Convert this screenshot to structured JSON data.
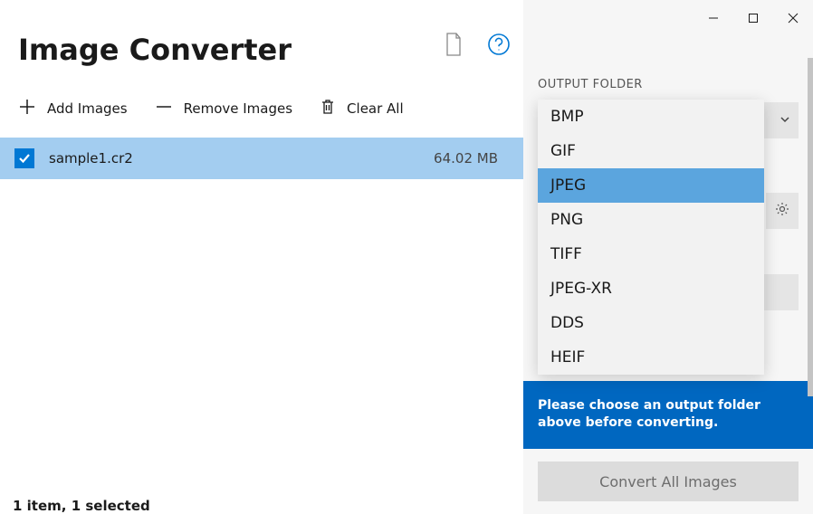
{
  "app": {
    "title": "Image Converter"
  },
  "toolbar": {
    "add": "Add Images",
    "remove": "Remove Images",
    "clear": "Clear All"
  },
  "files": [
    {
      "name": "sample1.cr2",
      "size": "64.02 MB",
      "checked": true
    }
  ],
  "status": "1 item, 1 selected",
  "side": {
    "output_folder_label": "OUTPUT FOLDER",
    "warning": "Please choose an output folder above before converting.",
    "convert": "Convert All Images"
  },
  "format_dropdown": {
    "options": [
      "BMP",
      "GIF",
      "JPEG",
      "PNG",
      "TIFF",
      "JPEG-XR",
      "DDS",
      "HEIF"
    ],
    "selected": "JPEG"
  }
}
